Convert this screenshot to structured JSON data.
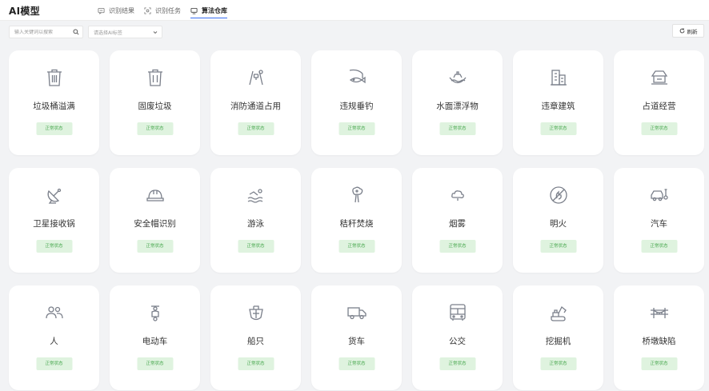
{
  "header": {
    "title": "AI模型",
    "tabs": [
      {
        "label": "识别结果",
        "icon": "message-icon",
        "active": false
      },
      {
        "label": "识别任务",
        "icon": "scan-icon",
        "active": false
      },
      {
        "label": "算法仓库",
        "icon": "monitor-icon",
        "active": true
      }
    ]
  },
  "toolbar": {
    "search_placeholder": "输入关键词以搜索",
    "select_placeholder": "请选择AI标签",
    "refresh_label": "刷新"
  },
  "colors": {
    "accent": "#3a6ff2",
    "badge_bg": "#dff3df",
    "badge_text": "#49a84f",
    "icon_stroke": "#7a7f8a"
  },
  "models": [
    {
      "name": "垃圾桶溢满",
      "status": "正常状态",
      "icon": "trash-can-icon"
    },
    {
      "name": "固废垃圾",
      "status": "正常状态",
      "icon": "trash-bin-icon"
    },
    {
      "name": "消防通道占用",
      "status": "正常状态",
      "icon": "fire-lane-icon"
    },
    {
      "name": "违规垂钓",
      "status": "正常状态",
      "icon": "fishing-icon"
    },
    {
      "name": "水面漂浮物",
      "status": "正常状态",
      "icon": "floating-object-icon"
    },
    {
      "name": "违章建筑",
      "status": "正常状态",
      "icon": "building-icon"
    },
    {
      "name": "占道经营",
      "status": "正常状态",
      "icon": "street-stall-icon"
    },
    {
      "name": "卫星接收锅",
      "status": "正常状态",
      "icon": "satellite-dish-icon"
    },
    {
      "name": "安全帽识别",
      "status": "正常状态",
      "icon": "hard-hat-icon"
    },
    {
      "name": "游泳",
      "status": "正常状态",
      "icon": "swimming-icon"
    },
    {
      "name": "秸秆焚烧",
      "status": "正常状态",
      "icon": "straw-burning-icon"
    },
    {
      "name": "烟雾",
      "status": "正常状态",
      "icon": "smoke-icon"
    },
    {
      "name": "明火",
      "status": "正常状态",
      "icon": "no-fire-icon"
    },
    {
      "name": "汽车",
      "status": "正常状态",
      "icon": "car-icon"
    },
    {
      "name": "人",
      "status": "正常状态",
      "icon": "people-icon"
    },
    {
      "name": "电动车",
      "status": "正常状态",
      "icon": "e-scooter-icon"
    },
    {
      "name": "船只",
      "status": "正常状态",
      "icon": "ship-icon"
    },
    {
      "name": "货车",
      "status": "正常状态",
      "icon": "truck-icon"
    },
    {
      "name": "公交",
      "status": "正常状态",
      "icon": "bus-icon"
    },
    {
      "name": "挖掘机",
      "status": "正常状态",
      "icon": "excavator-icon"
    },
    {
      "name": "桥墩缺陷",
      "status": "正常状态",
      "icon": "bridge-icon"
    }
  ]
}
